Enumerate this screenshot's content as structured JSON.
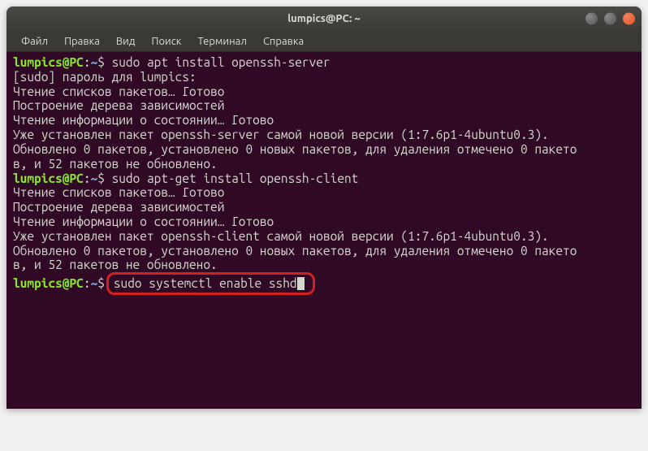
{
  "window": {
    "title": "lumpics@PC: ~"
  },
  "menubar": {
    "items": [
      "Файл",
      "Правка",
      "Вид",
      "Поиск",
      "Терминал",
      "Справка"
    ]
  },
  "prompt": {
    "user_host": "lumpics@PC",
    "path": "~",
    "symbol": "$"
  },
  "terminal": {
    "cmd1": "sudo apt install openssh-server",
    "line1": "[sudo] пароль для lumpics:",
    "line2": "Чтение списков пакетов… Готово",
    "line3": "Построение дерева зависимостей",
    "line4": "Чтение информации о состоянии… Готово",
    "line5": "Уже установлен пакет openssh-server самой новой версии (1:7.6p1-4ubuntu0.3).",
    "line6a": "Обновлено 0 пакетов, установлено 0 новых пакетов, для удаления отмечено 0 пакето",
    "line6b": "в, и 52 пакетов не обновлено.",
    "cmd2": "sudo apt-get install openssh-client",
    "line7": "Чтение списков пакетов… Готово",
    "line8": "Построение дерева зависимостей",
    "line9": "Чтение информации о состоянии… Готово",
    "line10": "Уже установлен пакет openssh-client самой новой версии (1:7.6p1-4ubuntu0.3).",
    "line11a": "Обновлено 0 пакетов, установлено 0 новых пакетов, для удаления отмечено 0 пакето",
    "line11b": "в, и 52 пакетов не обновлено.",
    "cmd3": "sudo systemctl enable sshd"
  }
}
